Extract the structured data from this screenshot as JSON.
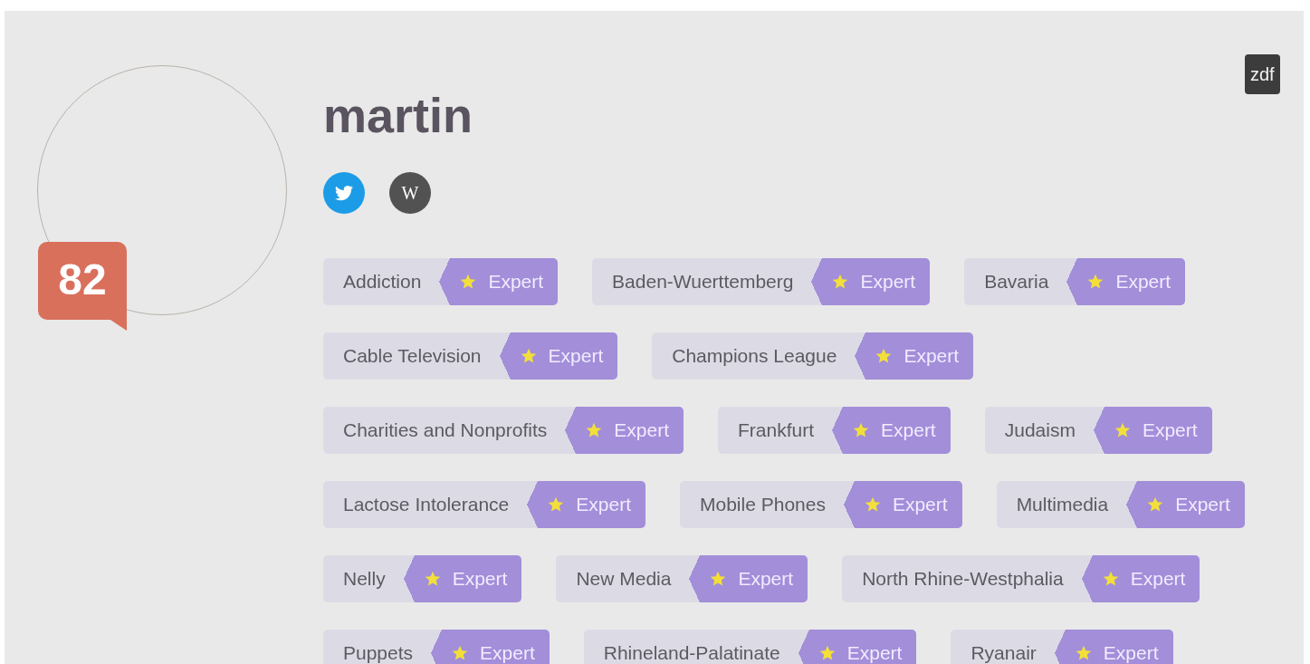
{
  "profile": {
    "name": "martin",
    "score": "82",
    "source": "zdf",
    "links": [
      {
        "kind": "twitter"
      },
      {
        "kind": "wikipedia",
        "label": "W"
      }
    ]
  },
  "tag_rows": [
    [
      {
        "topic": "Addiction",
        "rank": "Expert"
      },
      {
        "topic": "Baden-Wuerttemberg",
        "rank": "Expert"
      },
      {
        "topic": "Bavaria",
        "rank": "Expert"
      }
    ],
    [
      {
        "topic": "Cable Television",
        "rank": "Expert"
      },
      {
        "topic": "Champions League",
        "rank": "Expert"
      }
    ],
    [
      {
        "topic": "Charities and Nonprofits",
        "rank": "Expert"
      },
      {
        "topic": "Frankfurt",
        "rank": "Expert"
      },
      {
        "topic": "Judaism",
        "rank": "Expert"
      }
    ],
    [
      {
        "topic": "Lactose Intolerance",
        "rank": "Expert"
      },
      {
        "topic": "Mobile Phones",
        "rank": "Expert"
      },
      {
        "topic": "Multimedia",
        "rank": "Expert"
      }
    ],
    [
      {
        "topic": "Nelly",
        "rank": "Expert"
      },
      {
        "topic": "New Media",
        "rank": "Expert"
      },
      {
        "topic": "North Rhine-Westphalia",
        "rank": "Expert"
      }
    ],
    [
      {
        "topic": "Puppets",
        "rank": "Expert"
      },
      {
        "topic": "Rhineland-Palatinate",
        "rank": "Expert"
      },
      {
        "topic": "Ryanair",
        "rank": "Expert"
      }
    ]
  ]
}
